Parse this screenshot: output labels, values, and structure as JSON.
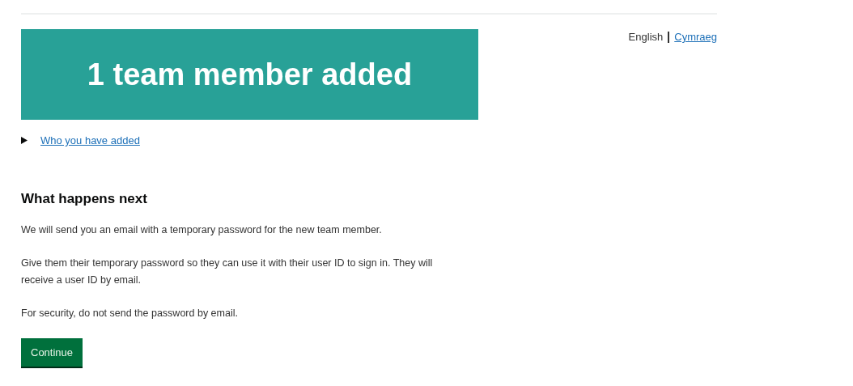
{
  "languages": [
    {
      "label": "English",
      "selected": true
    },
    {
      "label": "Cymraeg",
      "selected": false
    }
  ],
  "panel": {
    "title": "1 team member added"
  },
  "details": {
    "summary": "Who you have added",
    "expanded": false
  },
  "next_steps": {
    "heading": "What happens next",
    "paragraphs": [
      "We will send you an email with a temporary password for the new team member.",
      "Give them their temporary password so they can use it with their user ID to sign in. They will receive a user ID by email.",
      "For security, do not send the password by email."
    ]
  },
  "button": {
    "label": "Continue"
  }
}
